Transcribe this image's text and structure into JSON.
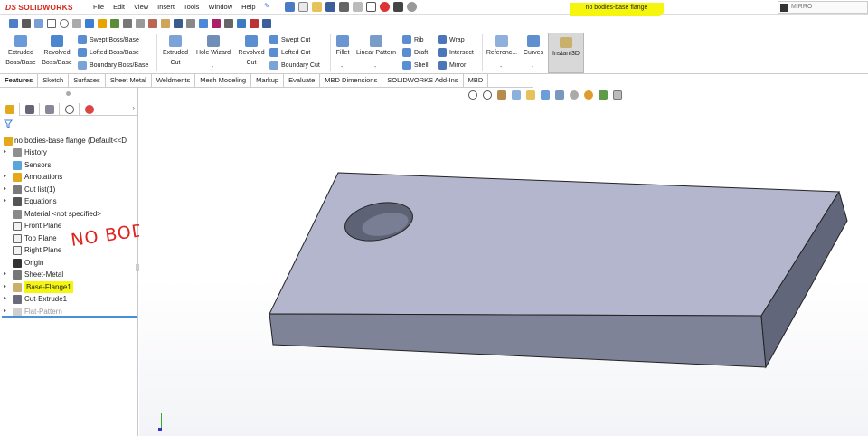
{
  "app": {
    "logo_brand": "DS",
    "logo_name": "SOLIDWORKS"
  },
  "menu": [
    "File",
    "Edit",
    "View",
    "Insert",
    "Tools",
    "Window",
    "Help"
  ],
  "document_title": "no bodies-base flange",
  "search": {
    "placeholder": "MIRRO"
  },
  "ribbon": {
    "extruded_boss": "Extruded Boss/Base",
    "revolved_boss": "Revolved Boss/Base",
    "swept_boss": "Swept Boss/Base",
    "lofted_boss": "Lofted Boss/Base",
    "boundary_boss": "Boundary Boss/Base",
    "extruded_cut": "Extruded Cut",
    "hole_wizard": "Hole Wizard",
    "revolved_cut": "Revolved Cut",
    "swept_cut": "Swept Cut",
    "lofted_cut": "Lofted Cut",
    "boundary_cut": "Boundary Cut",
    "fillet": "Fillet",
    "linear_pattern": "Linear Pattern",
    "rib": "Rib",
    "draft": "Draft",
    "shell": "Shell",
    "wrap": "Wrap",
    "intersect": "Intersect",
    "mirror": "Mirror",
    "reference": "Referenc...",
    "curves": "Curves",
    "instant3d": "Instant3D"
  },
  "tabs": [
    "Features",
    "Sketch",
    "Surfaces",
    "Sheet Metal",
    "Weldments",
    "Mesh Modeling",
    "Markup",
    "Evaluate",
    "MBD Dimensions",
    "SOLIDWORKS Add-Ins",
    "MBD"
  ],
  "tree": {
    "root": "no bodies-base flange  (Default<<D",
    "items": [
      {
        "label": "History",
        "icon": "history-icon",
        "arrow": true
      },
      {
        "label": "Sensors",
        "icon": "sensors-icon",
        "arrow": false
      },
      {
        "label": "Annotations",
        "icon": "annotations-icon",
        "arrow": true
      },
      {
        "label": "Cut list(1)",
        "icon": "cut-list-icon",
        "arrow": true
      },
      {
        "label": "Equations",
        "icon": "equations-icon",
        "arrow": true
      },
      {
        "label": "Material <not specified>",
        "icon": "material-icon",
        "arrow": false
      },
      {
        "label": "Front Plane",
        "icon": "plane-icon",
        "arrow": false
      },
      {
        "label": "Top Plane",
        "icon": "plane-icon",
        "arrow": false
      },
      {
        "label": "Right Plane",
        "icon": "plane-icon",
        "arrow": false
      },
      {
        "label": "Origin",
        "icon": "origin-icon",
        "arrow": false
      },
      {
        "label": "Sheet-Metal",
        "icon": "sheet-metal-icon",
        "arrow": true
      },
      {
        "label": "Base-Flange1",
        "icon": "base-flange-icon",
        "arrow": true
      },
      {
        "label": "Cut-Extrude1",
        "icon": "cut-extrude-icon",
        "arrow": true
      },
      {
        "label": "Flat-Pattern",
        "icon": "flat-pattern-icon",
        "arrow": true
      }
    ]
  },
  "annotation_text": "NO BODIES",
  "colors": {
    "highlight": "#f5f50e",
    "annotation": "#e0231f",
    "brand": "#d52b1e",
    "part_top": "#b4b6cd",
    "part_front": "#7f8398",
    "part_side": "#62667a"
  }
}
